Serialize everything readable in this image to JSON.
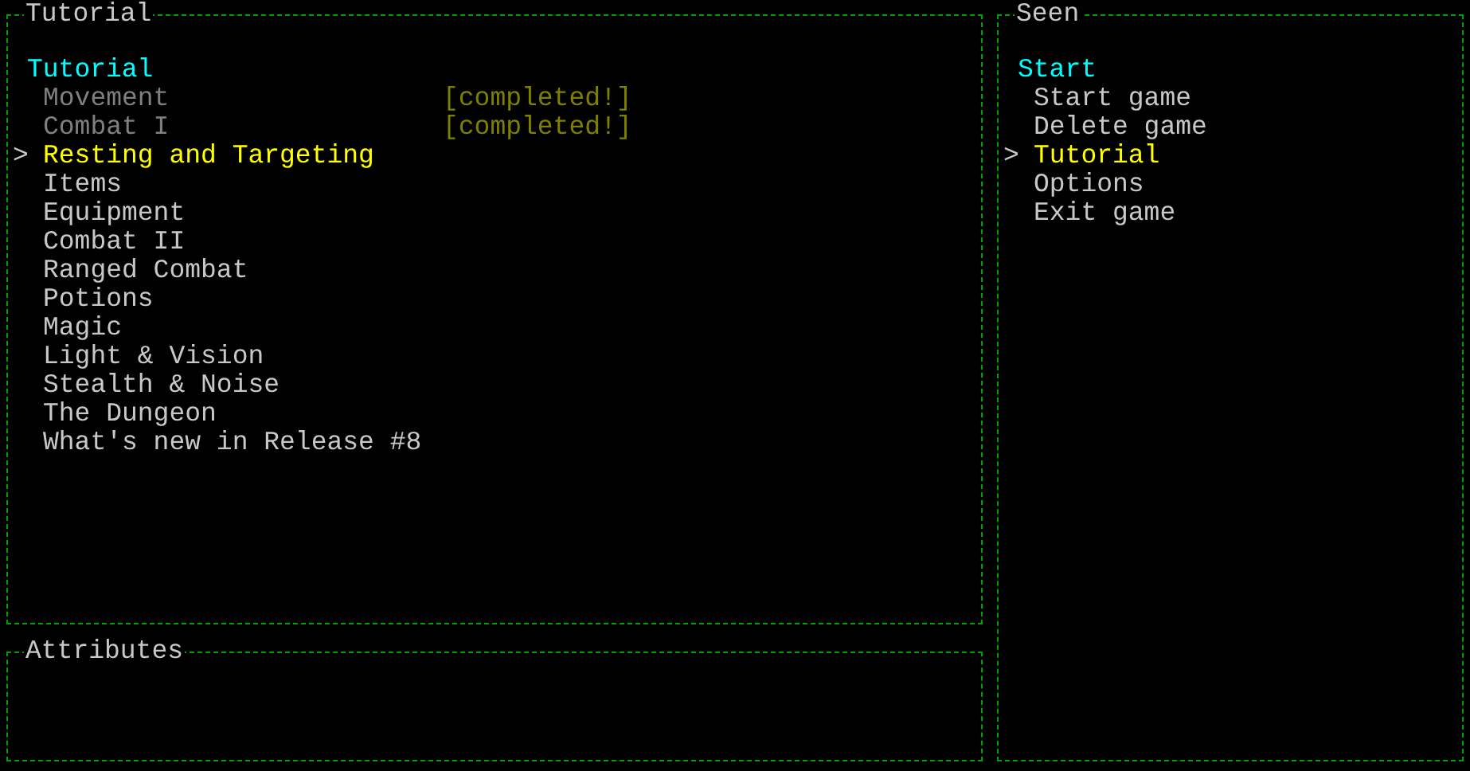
{
  "tutorial_panel": {
    "title": "Tutorial",
    "heading": "Tutorial",
    "items": [
      {
        "label": "Movement",
        "completed": true,
        "tag": "[completed!]",
        "selected": false
      },
      {
        "label": "Combat I",
        "completed": true,
        "tag": "[completed!]",
        "selected": false
      },
      {
        "label": "Resting and Targeting",
        "completed": false,
        "selected": true
      },
      {
        "label": "Items",
        "completed": false,
        "selected": false
      },
      {
        "label": "Equipment",
        "completed": false,
        "selected": false
      },
      {
        "label": "Combat II",
        "completed": false,
        "selected": false
      },
      {
        "label": "Ranged Combat",
        "completed": false,
        "selected": false
      },
      {
        "label": "Potions",
        "completed": false,
        "selected": false
      },
      {
        "label": "Magic",
        "completed": false,
        "selected": false
      },
      {
        "label": "Light & Vision",
        "completed": false,
        "selected": false
      },
      {
        "label": "Stealth & Noise",
        "completed": false,
        "selected": false
      },
      {
        "label": "The Dungeon",
        "completed": false,
        "selected": false
      },
      {
        "label": "What's new in Release #8",
        "completed": false,
        "selected": false
      }
    ],
    "cursor": ">"
  },
  "attributes_panel": {
    "title": "Attributes"
  },
  "seen_panel": {
    "title": "Seen",
    "heading": "Start",
    "items": [
      {
        "label": "Start game",
        "selected": false
      },
      {
        "label": "Delete game",
        "selected": false
      },
      {
        "label": "Tutorial",
        "selected": true
      },
      {
        "label": "Options",
        "selected": false
      },
      {
        "label": "Exit game",
        "selected": false
      }
    ],
    "cursor": ">"
  }
}
